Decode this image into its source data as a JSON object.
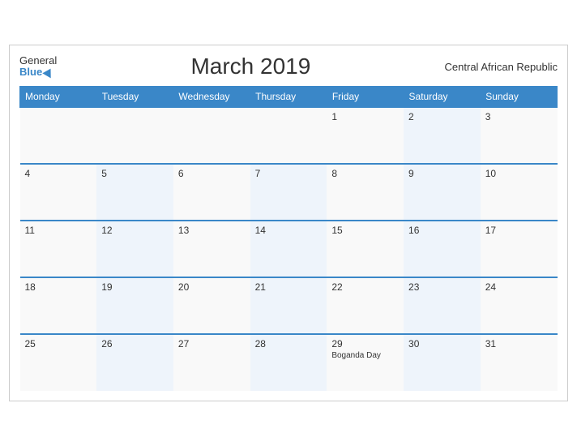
{
  "header": {
    "logo_general": "General",
    "logo_blue": "Blue",
    "title": "March 2019",
    "region": "Central African Republic"
  },
  "columns": [
    "Monday",
    "Tuesday",
    "Wednesday",
    "Thursday",
    "Friday",
    "Saturday",
    "Sunday"
  ],
  "weeks": [
    [
      {
        "day": "",
        "event": ""
      },
      {
        "day": "",
        "event": ""
      },
      {
        "day": "",
        "event": ""
      },
      {
        "day": "",
        "event": ""
      },
      {
        "day": "1",
        "event": ""
      },
      {
        "day": "2",
        "event": ""
      },
      {
        "day": "3",
        "event": ""
      }
    ],
    [
      {
        "day": "4",
        "event": ""
      },
      {
        "day": "5",
        "event": ""
      },
      {
        "day": "6",
        "event": ""
      },
      {
        "day": "7",
        "event": ""
      },
      {
        "day": "8",
        "event": ""
      },
      {
        "day": "9",
        "event": ""
      },
      {
        "day": "10",
        "event": ""
      }
    ],
    [
      {
        "day": "11",
        "event": ""
      },
      {
        "day": "12",
        "event": ""
      },
      {
        "day": "13",
        "event": ""
      },
      {
        "day": "14",
        "event": ""
      },
      {
        "day": "15",
        "event": ""
      },
      {
        "day": "16",
        "event": ""
      },
      {
        "day": "17",
        "event": ""
      }
    ],
    [
      {
        "day": "18",
        "event": ""
      },
      {
        "day": "19",
        "event": ""
      },
      {
        "day": "20",
        "event": ""
      },
      {
        "day": "21",
        "event": ""
      },
      {
        "day": "22",
        "event": ""
      },
      {
        "day": "23",
        "event": ""
      },
      {
        "day": "24",
        "event": ""
      }
    ],
    [
      {
        "day": "25",
        "event": ""
      },
      {
        "day": "26",
        "event": ""
      },
      {
        "day": "27",
        "event": ""
      },
      {
        "day": "28",
        "event": ""
      },
      {
        "day": "29",
        "event": "Boganda Day"
      },
      {
        "day": "30",
        "event": ""
      },
      {
        "day": "31",
        "event": ""
      }
    ]
  ]
}
